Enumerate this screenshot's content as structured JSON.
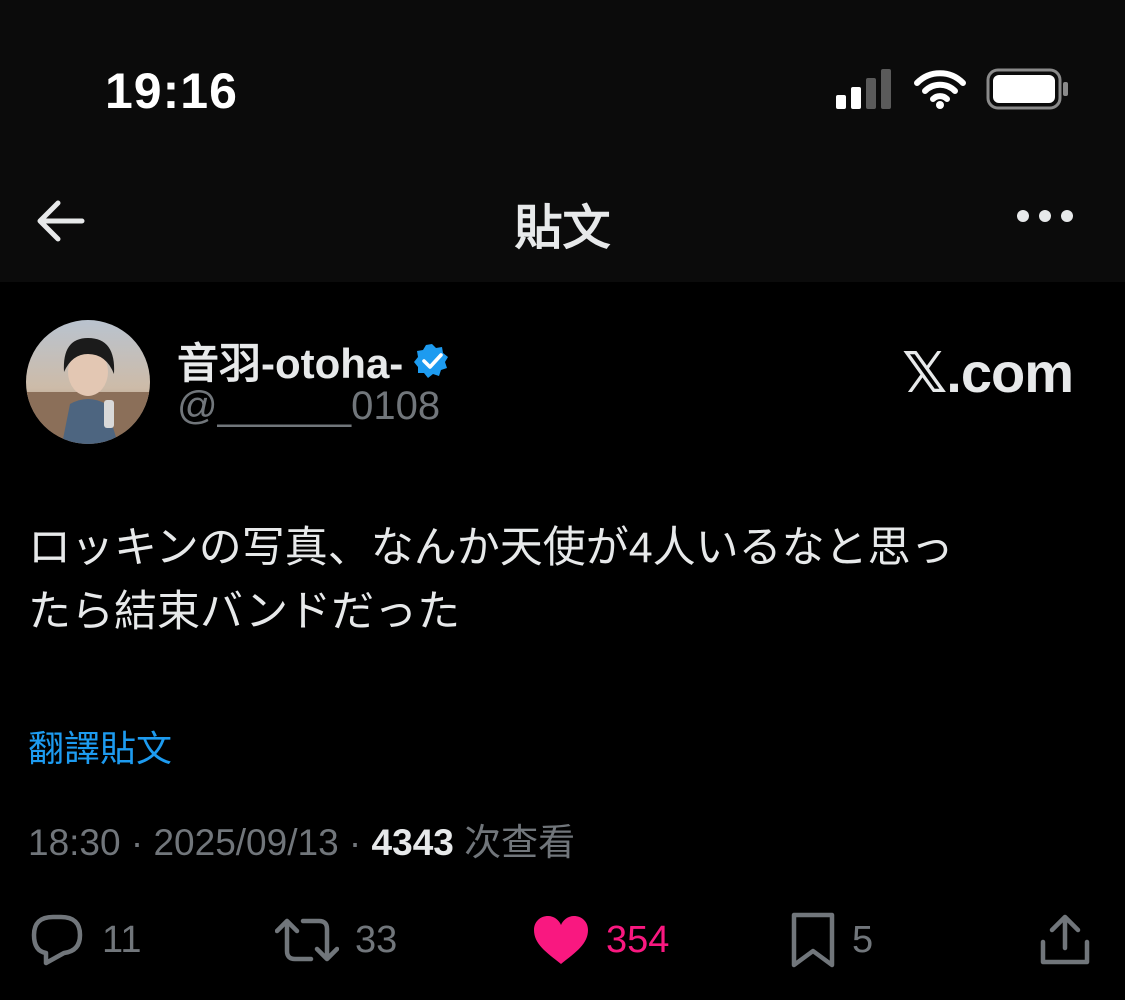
{
  "status_bar": {
    "time": "19:16",
    "icons": [
      "cellular-signal-icon",
      "wifi-icon",
      "battery-icon"
    ]
  },
  "nav": {
    "title": "貼文",
    "icons": [
      "back-arrow-icon",
      "more-icon"
    ]
  },
  "post": {
    "author_name": "音羽-otoha-",
    "handle": "@______0108",
    "verified_icon": "verified-badge-icon",
    "source_logo": "𝕏.com",
    "text_line1": "ロッキンの写真、なんか天使が4人いるなと思っ",
    "text_line2": "たら結束バンドだった",
    "translate_label": "翻譯貼文",
    "meta_time": "18:30 · 2025/09/13 · ",
    "meta_views_count": "4343",
    "meta_views_label": " 次查看"
  },
  "actions": {
    "reply_count": "11",
    "repost_count": "33",
    "like_count": "354",
    "bookmark_count": "5",
    "icons": [
      "reply-icon",
      "repost-icon",
      "like-icon",
      "bookmark-icon",
      "share-icon"
    ]
  },
  "colors": {
    "background": "#000000",
    "accent_blue": "#1d9bf0",
    "like_pink": "#f91880",
    "muted": "#71767b",
    "text": "#e7e9ea"
  }
}
